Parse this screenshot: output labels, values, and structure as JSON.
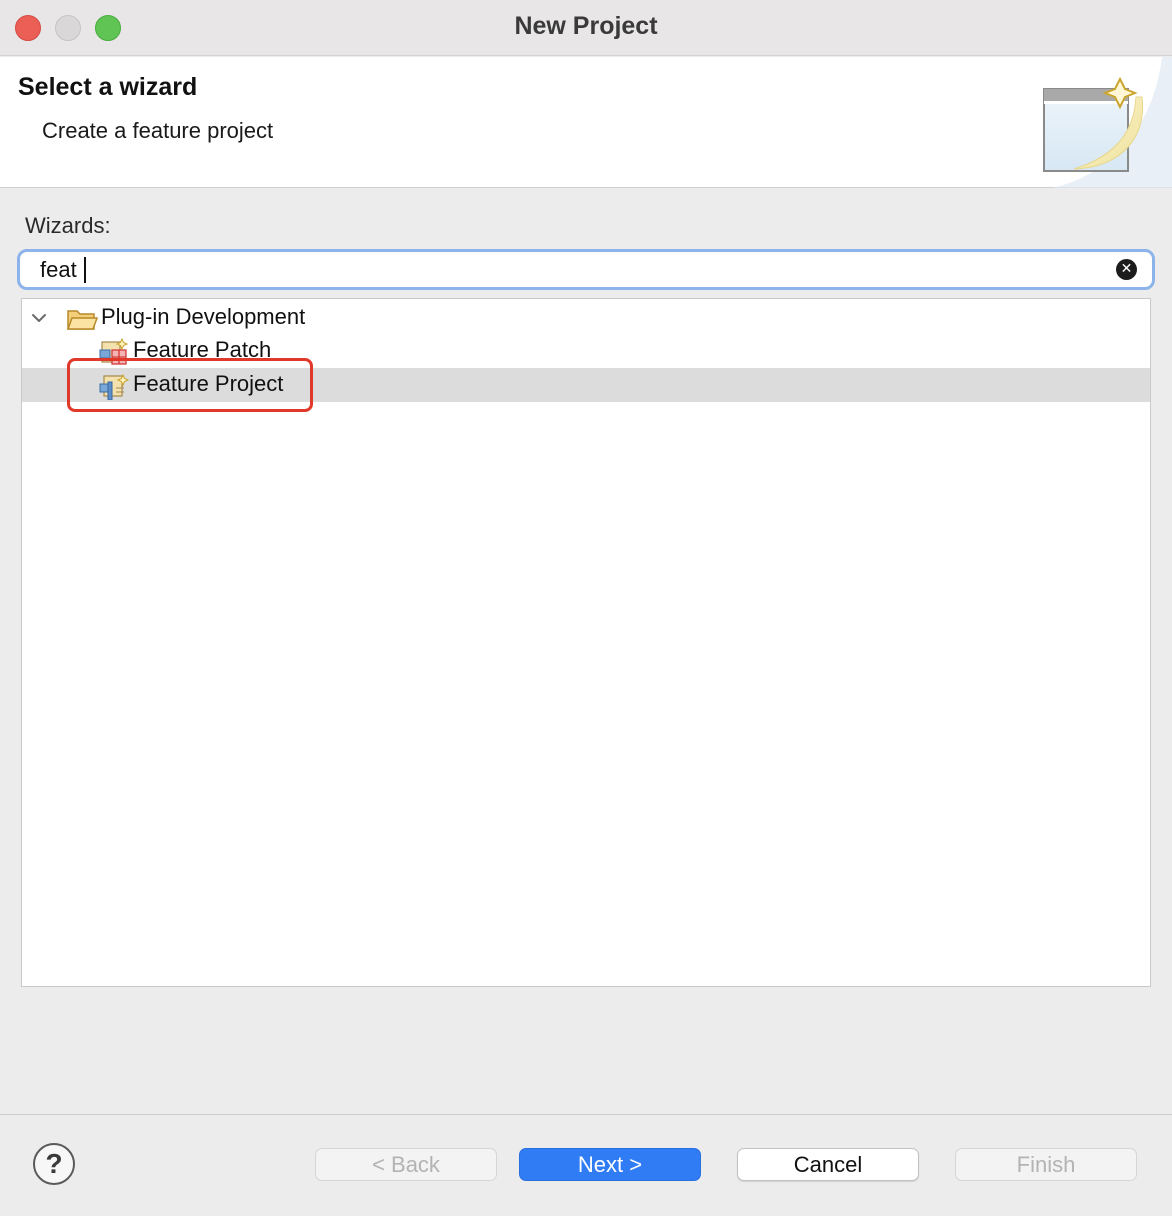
{
  "window": {
    "title": "New Project"
  },
  "banner": {
    "title": "Select a wizard",
    "description": "Create a feature project"
  },
  "wizards": {
    "label": "Wizards:",
    "search_value": "feat",
    "clear_icon": "clear-search-icon"
  },
  "tree": {
    "category": {
      "label": "Plug-in Development",
      "icon": "open-folder-icon",
      "expanded": true
    },
    "items": [
      {
        "label": "Feature Patch",
        "icon": "feature-patch-icon",
        "selected": false
      },
      {
        "label": "Feature Project",
        "icon": "feature-project-icon",
        "selected": true
      }
    ]
  },
  "footer": {
    "help_label": "?",
    "back_label": "< Back",
    "next_label": "Next >",
    "cancel_label": "Cancel",
    "finish_label": "Finish"
  },
  "colors": {
    "accent": "#2f7cf4",
    "selection": "#dcdcdc",
    "highlight": "#e0392a",
    "search_focus": "#8cb3ea"
  }
}
